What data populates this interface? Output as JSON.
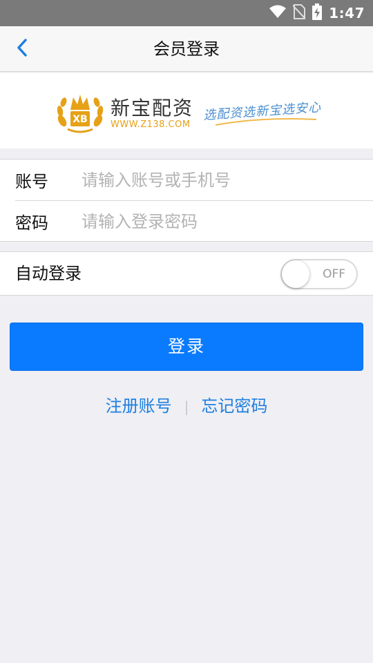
{
  "status_bar": {
    "time": "1:47",
    "icons": [
      "wifi-icon",
      "no-sim-icon",
      "battery-charging-icon"
    ]
  },
  "nav": {
    "title": "会员登录",
    "back_icon": "chevron-left-icon"
  },
  "banner": {
    "logo_badge": "XB",
    "logo_name": "新宝配资",
    "logo_url": "WWW.Z138.COM",
    "slogan": "选配资选新宝选安心"
  },
  "form": {
    "account_label": "账号",
    "account_placeholder": "请输入账号或手机号",
    "account_value": "",
    "password_label": "密码",
    "password_placeholder": "请输入登录密码",
    "password_value": ""
  },
  "auto_login": {
    "label": "自动登录",
    "toggle_text": "OFF",
    "enabled": false
  },
  "actions": {
    "login_label": "登录",
    "register_label": "注册账号",
    "separator": "|",
    "forgot_label": "忘记密码"
  },
  "colors": {
    "primary": "#0a7bff",
    "link": "#1e7fe0",
    "background": "#efeff4",
    "logo_gold": "#e6a117"
  }
}
